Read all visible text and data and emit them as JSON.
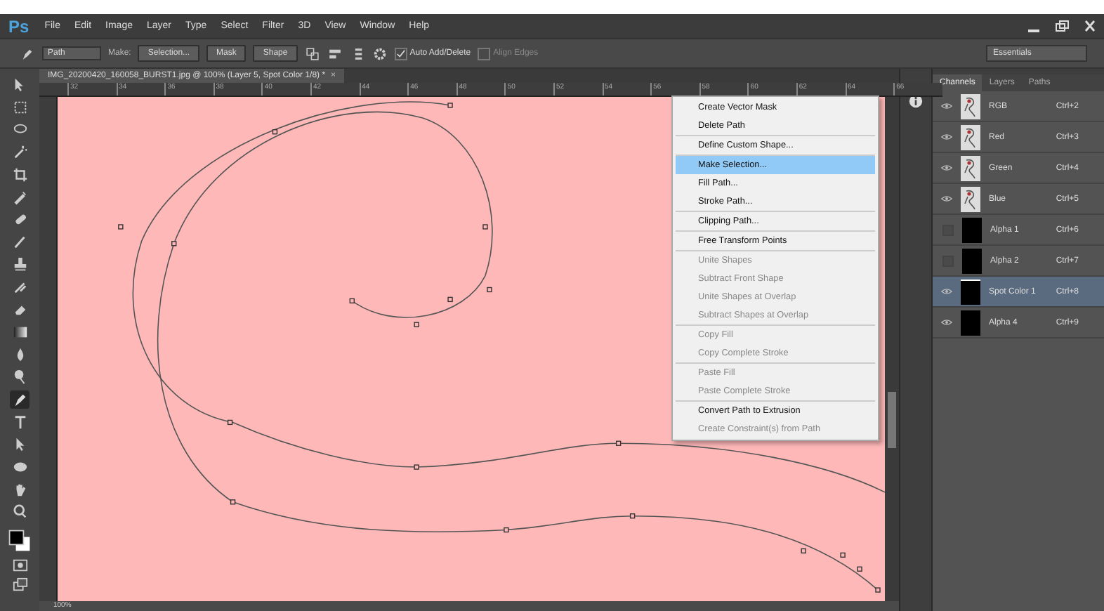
{
  "app": {
    "logo": "Ps",
    "menu": [
      "File",
      "Edit",
      "Image",
      "Layer",
      "Type",
      "Select",
      "Filter",
      "3D",
      "View",
      "Window",
      "Help"
    ]
  },
  "options_bar": {
    "mode": "Path",
    "make_label": "Make:",
    "buttons": [
      "Selection...",
      "Mask",
      "Shape"
    ],
    "checkboxes": [
      {
        "label": "Auto Add/Delete",
        "checked": true,
        "disabled": false
      },
      {
        "label": "Align Edges",
        "checked": false,
        "disabled": true
      }
    ],
    "workspace": "Essentials"
  },
  "document": {
    "tab": "IMG_20200420_160058_BURST1.jpg @ 100% (Layer 5, Spot Color 1/8) *",
    "close": "×",
    "ruler": [
      "32",
      "34",
      "36",
      "38",
      "40",
      "42",
      "44",
      "46",
      "48",
      "50",
      "52",
      "54",
      "56",
      "58",
      "60",
      "62",
      "64",
      "66"
    ]
  },
  "tools": [
    {
      "kind": "move",
      "selected": false
    },
    {
      "kind": "marquee",
      "selected": false
    },
    {
      "kind": "lasso",
      "selected": false
    },
    {
      "kind": "wand",
      "selected": false
    },
    {
      "kind": "crop",
      "selected": false
    },
    {
      "kind": "eyedropper",
      "selected": false
    },
    {
      "kind": "bandage",
      "selected": false
    },
    {
      "kind": "brush",
      "selected": false
    },
    {
      "kind": "stamp",
      "selected": false
    },
    {
      "kind": "history",
      "selected": false
    },
    {
      "kind": "eraser",
      "selected": false
    },
    {
      "kind": "gradient",
      "selected": false
    },
    {
      "kind": "drop",
      "selected": false
    },
    {
      "kind": "dodge",
      "selected": false
    },
    {
      "kind": "pen",
      "selected": true
    },
    {
      "kind": "type",
      "selected": false
    },
    {
      "kind": "arrow",
      "selected": false
    },
    {
      "kind": "ellipse",
      "selected": false
    },
    {
      "kind": "hand",
      "selected": false
    },
    {
      "kind": "zoom",
      "selected": false
    }
  ],
  "context_menu": [
    [
      {
        "label": "Create Vector Mask",
        "disabled": false,
        "selected": false
      },
      {
        "label": "Delete Path",
        "disabled": false,
        "selected": false
      }
    ],
    [
      {
        "label": "Define Custom Shape...",
        "disabled": false,
        "selected": false
      }
    ],
    [
      {
        "label": "Make Selection...",
        "disabled": false,
        "selected": true
      },
      {
        "label": "Fill Path...",
        "disabled": false,
        "selected": false
      },
      {
        "label": "Stroke Path...",
        "disabled": false,
        "selected": false
      }
    ],
    [
      {
        "label": "Clipping Path...",
        "disabled": false,
        "selected": false
      }
    ],
    [
      {
        "label": "Free Transform Points",
        "disabled": false,
        "selected": false
      }
    ],
    [
      {
        "label": "Unite Shapes",
        "disabled": true,
        "selected": false
      },
      {
        "label": "Subtract Front Shape",
        "disabled": true,
        "selected": false
      },
      {
        "label": "Unite Shapes at Overlap",
        "disabled": true,
        "selected": false
      },
      {
        "label": "Subtract Shapes at Overlap",
        "disabled": true,
        "selected": false
      }
    ],
    [
      {
        "label": "Copy Fill",
        "disabled": true,
        "selected": false
      },
      {
        "label": "Copy Complete Stroke",
        "disabled": true,
        "selected": false
      }
    ],
    [
      {
        "label": "Paste Fill",
        "disabled": true,
        "selected": false
      },
      {
        "label": "Paste Complete Stroke",
        "disabled": true,
        "selected": false
      }
    ],
    [
      {
        "label": "Convert Path to Extrusion",
        "disabled": false,
        "selected": false
      },
      {
        "label": "Create Constraint(s) from Path",
        "disabled": true,
        "selected": false
      }
    ]
  ],
  "panel": {
    "tabs": [
      {
        "label": "Channels",
        "selected": true
      },
      {
        "label": "Layers",
        "selected": false
      },
      {
        "label": "Paths",
        "selected": false
      }
    ],
    "channels": [
      {
        "name": "RGB",
        "shortcut": "Ctrl+2",
        "visible": true,
        "selected": false,
        "kind": "image"
      },
      {
        "name": "Red",
        "shortcut": "Ctrl+3",
        "visible": true,
        "selected": false,
        "kind": "image"
      },
      {
        "name": "Green",
        "shortcut": "Ctrl+4",
        "visible": true,
        "selected": false,
        "kind": "image"
      },
      {
        "name": "Blue",
        "shortcut": "Ctrl+5",
        "visible": true,
        "selected": false,
        "kind": "image"
      },
      {
        "name": "Alpha 1",
        "shortcut": "Ctrl+6",
        "visible": false,
        "selected": false,
        "kind": "black"
      },
      {
        "name": "Alpha 2",
        "shortcut": "Ctrl+7",
        "visible": false,
        "selected": false,
        "kind": "black"
      },
      {
        "name": "Spot Color 1",
        "shortcut": "Ctrl+8",
        "visible": true,
        "selected": true,
        "kind": "black"
      },
      {
        "name": "Alpha 4",
        "shortcut": "Ctrl+9",
        "visible": true,
        "selected": false,
        "kind": "black"
      }
    ]
  },
  "status_bar": {
    "zoom": "100%"
  }
}
